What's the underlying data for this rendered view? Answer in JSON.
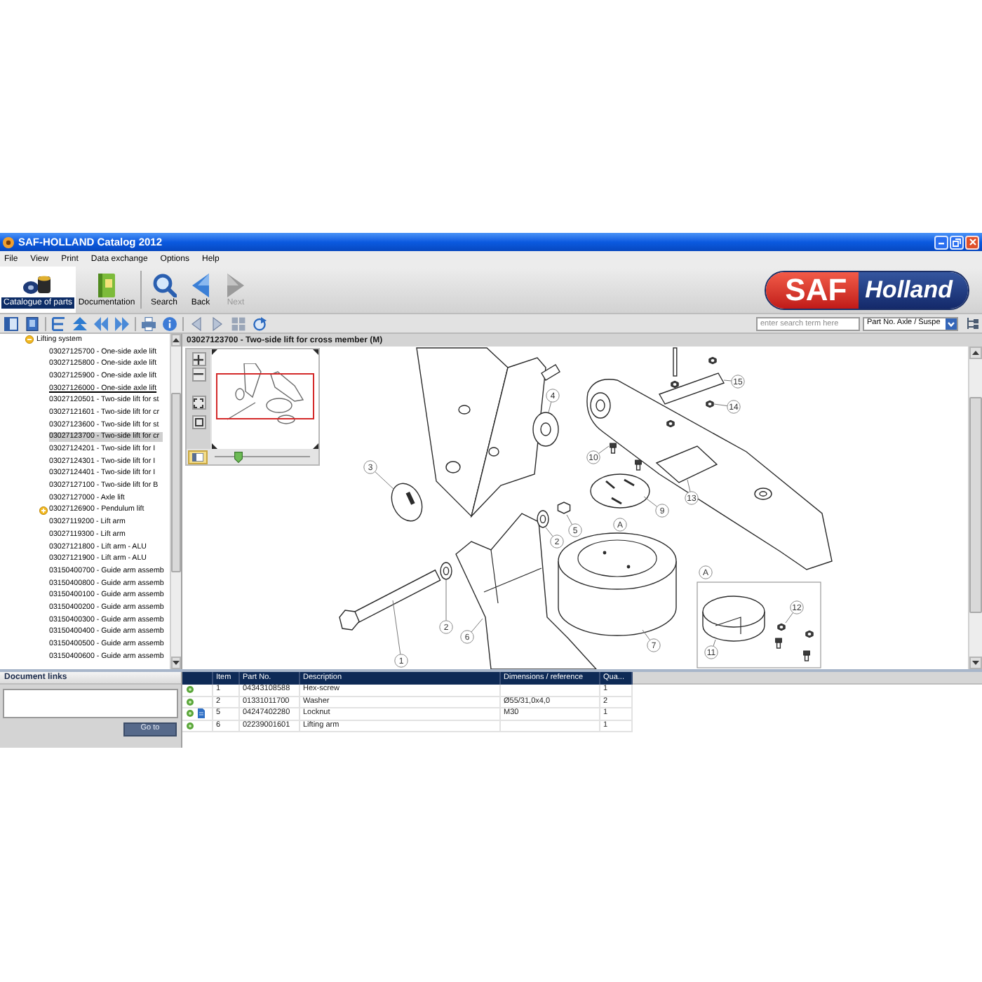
{
  "window": {
    "title": "SAF-HOLLAND Catalog 2012"
  },
  "menu": [
    "File",
    "View",
    "Print",
    "Data exchange",
    "Options",
    "Help"
  ],
  "toolbar": [
    {
      "label": "Catalogue of parts",
      "selected": true,
      "disabled": false
    },
    {
      "label": "Documentation",
      "selected": false,
      "disabled": false
    },
    {
      "label": "Search",
      "selected": false,
      "disabled": false
    },
    {
      "label": "Back",
      "selected": false,
      "disabled": false
    },
    {
      "label": "Next",
      "selected": false,
      "disabled": true
    }
  ],
  "logo": {
    "left": "SAF",
    "right": "Holland"
  },
  "search": {
    "placeholder": "enter search term here",
    "scope": "Part No. Axle / Suspe"
  },
  "tree": {
    "label": "Lifting system",
    "expanded": true,
    "children": [
      {
        "label": "03027125700 - One-side axle lift",
        "kind": "part",
        "selected": false,
        "hovered": false
      },
      {
        "label": "03027125800 - One-side axle lift",
        "kind": "part",
        "selected": false,
        "hovered": false
      },
      {
        "label": "03027125900 - One-side axle lift",
        "kind": "part",
        "selected": false,
        "hovered": false
      },
      {
        "label": "03027126000 - One-side axle lift",
        "kind": "part",
        "selected": false,
        "hovered": true
      },
      {
        "label": "03027120501 - Two-side lift for st",
        "kind": "part",
        "selected": false,
        "hovered": false
      },
      {
        "label": "03027121601 - Two-side lift for cr",
        "kind": "part",
        "selected": false,
        "hovered": false
      },
      {
        "label": "03027123600 - Two-side lift for st",
        "kind": "part",
        "selected": false,
        "hovered": false
      },
      {
        "label": "03027123700 - Two-side lift for cr",
        "kind": "part",
        "selected": true,
        "hovered": false
      },
      {
        "label": "03027124201 - Two-side lift for I",
        "kind": "part",
        "selected": false,
        "hovered": false
      },
      {
        "label": "03027124301 - Two-side lift for I",
        "kind": "part",
        "selected": false,
        "hovered": false
      },
      {
        "label": "03027124401 - Two-side lift for I",
        "kind": "part",
        "selected": false,
        "hovered": false
      },
      {
        "label": "03027127100 - Two-side lift for B",
        "kind": "part",
        "selected": false,
        "hovered": false
      },
      {
        "label": "03027127000 - Axle lift",
        "kind": "part",
        "selected": false,
        "hovered": false
      },
      {
        "label": "03027126900 - Pendulum lift",
        "kind": "group",
        "expanded": false,
        "selected": false,
        "hovered": false
      },
      {
        "label": "03027119200 - Lift arm",
        "kind": "part",
        "selected": false,
        "hovered": false
      },
      {
        "label": "03027119300 - Lift arm",
        "kind": "part",
        "selected": false,
        "hovered": false
      },
      {
        "label": "03027121800 - Lift arm - ALU",
        "kind": "part",
        "selected": false,
        "hovered": false
      },
      {
        "label": "03027121900 - Lift arm - ALU",
        "kind": "part",
        "selected": false,
        "hovered": false
      },
      {
        "label": "03150400700 - Guide arm assemb",
        "kind": "part",
        "selected": false,
        "hovered": false
      },
      {
        "label": "03150400800 - Guide arm assemb",
        "kind": "part",
        "selected": false,
        "hovered": false
      },
      {
        "label": "03150400100 - Guide arm assemb",
        "kind": "part",
        "selected": false,
        "hovered": false
      },
      {
        "label": "03150400200 - Guide arm assemb",
        "kind": "part",
        "selected": false,
        "hovered": false
      },
      {
        "label": "03150400300 - Guide arm assemb",
        "kind": "part",
        "selected": false,
        "hovered": false
      },
      {
        "label": "03150400400 - Guide arm assemb",
        "kind": "part",
        "selected": false,
        "hovered": false
      },
      {
        "label": "03150400500 - Guide arm assemb",
        "kind": "part",
        "selected": false,
        "hovered": false
      },
      {
        "label": "03150400600 - Guide arm assemb",
        "kind": "part",
        "selected": false,
        "hovered": false
      }
    ]
  },
  "drawing": {
    "title": "03027123700 - Two-side lift for cross member (M)",
    "zoom": {
      "level": 0.25
    },
    "callouts": [
      "4",
      "3",
      "15",
      "14",
      "10",
      "13",
      "9",
      "5",
      "2",
      "2",
      "6",
      "1",
      "A",
      "7",
      "A",
      "12",
      "11"
    ]
  },
  "document_links": {
    "title": "Document links",
    "button": "Go to"
  },
  "parts_table": {
    "columns": [
      "Item",
      "Part No.",
      "Description",
      "Dimensions / reference",
      "Qua..."
    ],
    "rows": [
      {
        "item": "1",
        "part_no": "04343108588",
        "description": "Hex-screw",
        "quantity": "1",
        "document": false
      },
      {
        "item": "2",
        "part_no": "01331011700",
        "description": "Washer",
        "dimensions": "Ø55/31,0x4,0",
        "quantity": "2",
        "document": false
      },
      {
        "item": "5",
        "part_no": "04247402280",
        "description": "Locknut",
        "dimensions": "M30",
        "quantity": "1",
        "document": true
      },
      {
        "item": "6",
        "part_no": "02239001601",
        "description": "Lifting arm",
        "quantity": "1",
        "document": false
      }
    ]
  }
}
